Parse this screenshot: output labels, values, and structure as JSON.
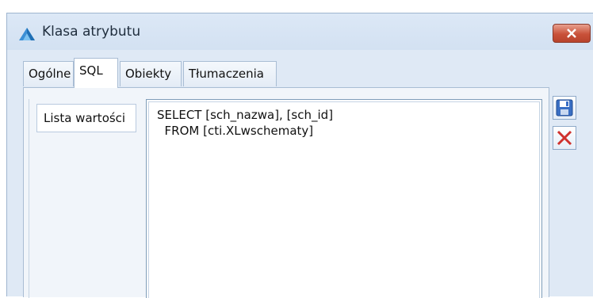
{
  "window": {
    "title": "Klasa atrybutu",
    "close_icon": "close-icon",
    "app_icon": "triangle-app-icon"
  },
  "tabs": [
    {
      "label": "Ogólne",
      "active": false
    },
    {
      "label": "SQL",
      "active": true
    },
    {
      "label": "Obiekty",
      "active": false
    },
    {
      "label": "Tłumaczenia",
      "active": false
    }
  ],
  "sql_panel": {
    "field_label": "Lista wartości",
    "query_lines": [
      "SELECT [sch_nazwa], [sch_id]",
      "  FROM [cti.XLwschematy]"
    ]
  },
  "toolbar": {
    "save_icon": "save-icon",
    "cancel_icon": "cancel-x-icon"
  },
  "colors": {
    "window_bg": "#dfe9f5",
    "close_button": "#c9523a",
    "cancel_icon": "#d0312d",
    "save_icon": "#3a6fc4"
  }
}
